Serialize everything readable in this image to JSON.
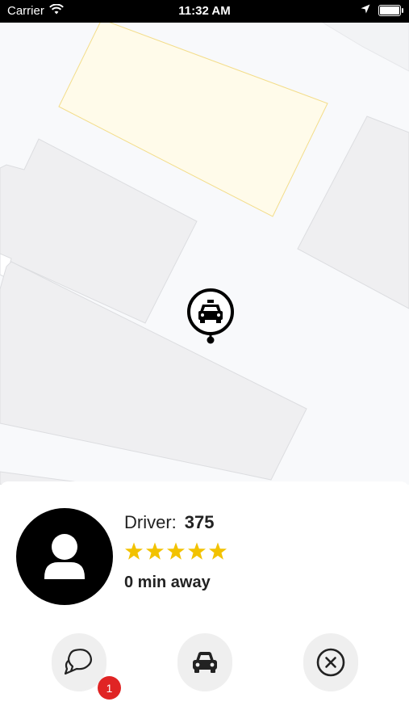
{
  "status_bar": {
    "carrier": "Carrier",
    "time": "11:32 AM",
    "wifi_icon": "wifi-icon",
    "location_icon": "location-arrow-icon",
    "battery_icon": "battery-icon"
  },
  "map": {
    "marker_icon": "taxi-marker-icon",
    "colors": {
      "background": "#f8f9fb",
      "building": "#efeff1",
      "highlight": "#fffbea",
      "highlight_stroke": "#f3dd8a"
    }
  },
  "driver": {
    "label": "Driver:",
    "number": "375",
    "rating_stars": 5,
    "eta": "0 min away",
    "avatar_icon": "person-icon"
  },
  "actions": {
    "chat_icon": "chat-bubbles-icon",
    "chat_badge": "1",
    "car_icon": "car-icon",
    "cancel_icon": "close-circle-icon"
  },
  "colors": {
    "star": "#f2c200",
    "badge": "#e02424",
    "action_bg": "#efefef"
  }
}
